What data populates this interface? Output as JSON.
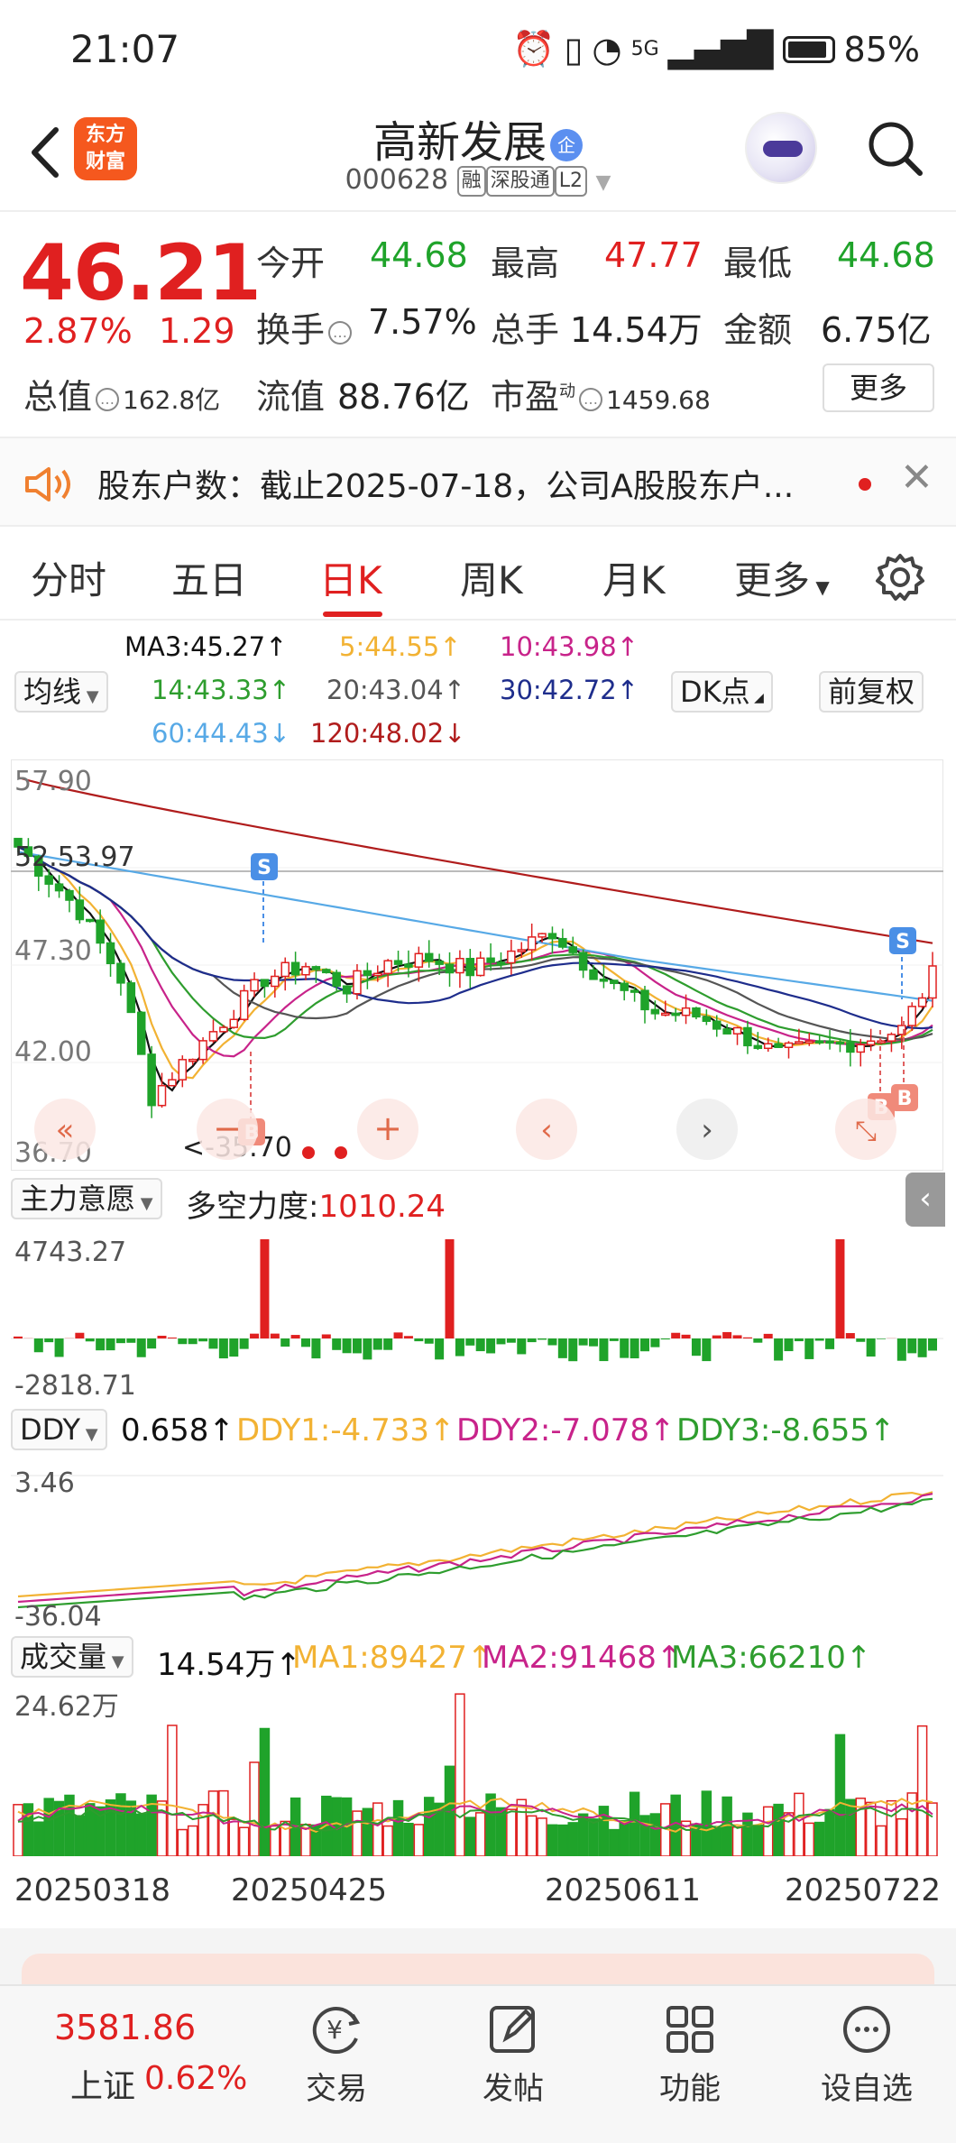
{
  "status_bar": {
    "time": "21:07",
    "battery": "85%",
    "net": "5G"
  },
  "header": {
    "logo_line1": "东方",
    "logo_line2": "财富",
    "title": "高新发展",
    "badge": "企",
    "code": "000628",
    "tags": [
      "融",
      "深股通",
      "L2"
    ]
  },
  "quote": {
    "price": "46.21",
    "change_pct": "2.87%",
    "change": "1.29",
    "open_label": "今开",
    "open": "44.68",
    "high_label": "最高",
    "high": "47.77",
    "low_label": "最低",
    "low": "44.68",
    "turnover_label": "换手",
    "turnover": "7.57%",
    "volume_label": "总手",
    "volume": "14.54万",
    "amount_label": "金额",
    "amount": "6.75亿",
    "mcap_label": "总值",
    "mcap": "162.8亿",
    "float_label": "流值",
    "float": "88.76亿",
    "pe_label": "市盈",
    "pe_sup": "动",
    "pe": "1459.68",
    "more": "更多"
  },
  "notice": {
    "text": "股东户数：截止2025-07-18，公司A股股东户..."
  },
  "tabs": [
    "分时",
    "五日",
    "日K",
    "周K",
    "月K",
    "更多"
  ],
  "ma_legend": {
    "ma3": "MA3:45.27↑",
    "ma5": "5:44.55↑",
    "ma10": "10:43.98↑",
    "ma14": "14:43.33↑",
    "ma20": "20:43.04↑",
    "ma30": "30:42.72↑",
    "ma60": "60:44.43↓",
    "ma120": "120:48.02↓",
    "line_select": "均线",
    "dk": "DK点",
    "fq": "前复权"
  },
  "kline": {
    "y_top": "57.90",
    "y_mid1": "47.30",
    "y_mid2": "42.00",
    "y_bot": "36.70",
    "hline_label": "52.53.97",
    "low_label": "<-35.70",
    "s_mark": "S",
    "b_mark": "B"
  },
  "main_force": {
    "select": "主力意愿",
    "label": "多空力度:",
    "value": "1010.24",
    "y_top": "4743.27",
    "y_bot": "-2818.71"
  },
  "ddy": {
    "select": "DDY",
    "v0": "0.658↑",
    "v1": "DDY1:-4.733↑",
    "v2": "DDY2:-7.078↑",
    "v3": "DDY3:-8.655↑",
    "y_top": "3.46",
    "y_bot": "-36.04"
  },
  "volume": {
    "select": "成交量",
    "v0": "14.54万↑",
    "ma1": "MA1:89427↑",
    "ma2": "MA2:91468↑",
    "ma3": "MA3:66210↑",
    "y_top": "24.62万"
  },
  "dates": [
    "20250318",
    "20250425",
    "20250611",
    "20250722"
  ],
  "bottom_nav": {
    "index_name": "上证",
    "index_value": "3581.86",
    "index_pct": "0.62%",
    "items": [
      "交易",
      "发帖",
      "功能",
      "设自选"
    ]
  },
  "colors": {
    "red": "#e02020",
    "green": "#1fa32a",
    "ma3": "#111111",
    "ma5": "#f2b233",
    "ma10": "#c8238a",
    "ma14": "#2e9d2e",
    "ma20": "#555555",
    "ma30": "#1e2d8c",
    "ma60": "#57a9e6",
    "ma120": "#b01c1c"
  }
}
